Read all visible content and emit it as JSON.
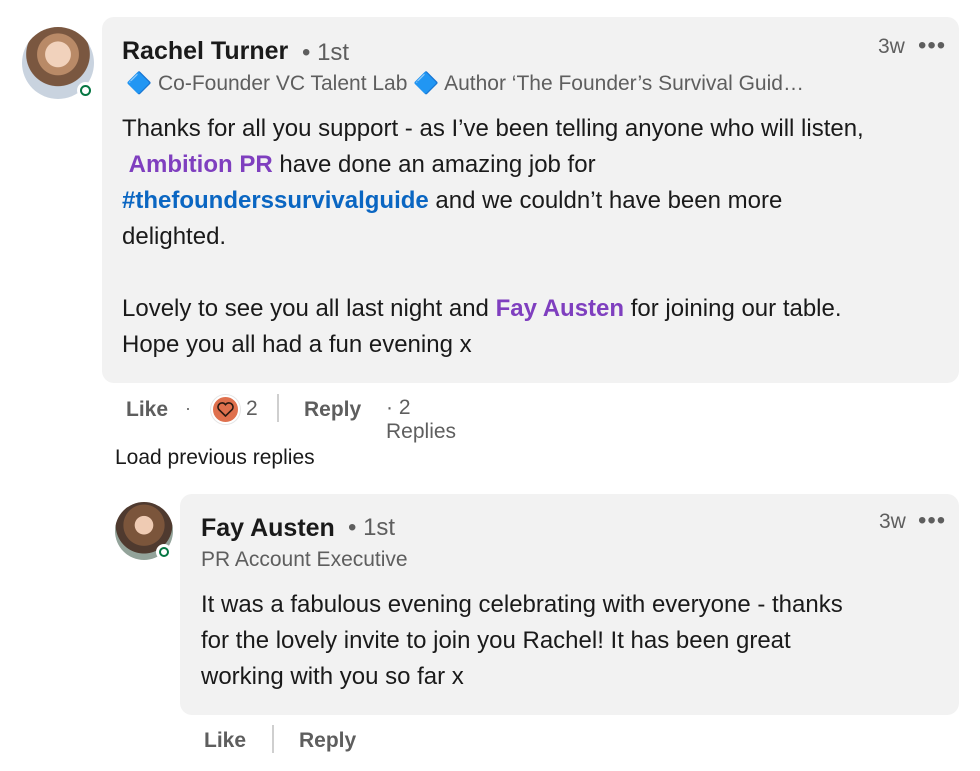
{
  "comment": {
    "author": "Rachel Turner",
    "degree": "• 1st",
    "headline": "🔷 Co-Founder VC Talent Lab 🔷 Author ‘The Founder’s Survival Guid…",
    "time": "3w",
    "more_icon": "•••",
    "body": {
      "line1": "Thanks for all you support - as I’ve been telling anyone who will listen,",
      "mention1": "Ambition PR",
      "line2_rest": " have done an amazing job for",
      "hashtag": "#thefounderssurvivalguide",
      "line3_rest": " and we couldn’t have been more",
      "line4": "delighted.",
      "line5_start": "Lovely to see you all last night and ",
      "mention2": "Fay Austen",
      "line5_rest": " for joining our table.",
      "line6": "Hope you all had a fun evening x"
    },
    "actions": {
      "like": "Like",
      "dot": "·",
      "reaction_count": "2",
      "reply": "Reply",
      "replies": "· 2 Replies"
    }
  },
  "load_previous": "Load previous replies",
  "reply": {
    "author": "Fay Austen",
    "degree": "• 1st",
    "headline": "PR Account Executive",
    "time": "3w",
    "more_icon": "•••",
    "body": {
      "line1": "It was a fabulous evening celebrating with everyone - thanks",
      "line2": "for the lovely invite to join you Rachel! It has been great",
      "line3": "working with you so far x"
    },
    "actions": {
      "like": "Like",
      "reply": "Reply"
    }
  },
  "colors": {
    "bubble": "#f2f2f2",
    "mention": "#7f3fbf",
    "hashtag": "#0a66c2",
    "presence": "#057642",
    "reaction": "#df704d"
  },
  "icons": {
    "reaction": "heart-icon",
    "more": "more-horizontal-icon",
    "presence": "online-status-icon"
  }
}
